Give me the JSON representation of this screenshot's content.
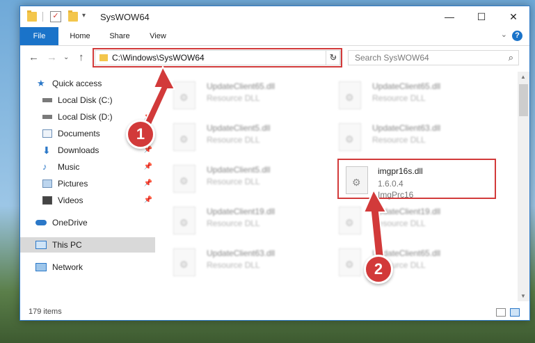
{
  "window": {
    "title": "SysWOW64",
    "controls": {
      "minimize": "—",
      "maximize": "☐",
      "close": "✕"
    }
  },
  "ribbon": {
    "tabs": [
      {
        "label": "File"
      },
      {
        "label": "Home"
      },
      {
        "label": "Share"
      },
      {
        "label": "View"
      }
    ],
    "help": "?"
  },
  "navigation": {
    "back": "←",
    "forward": "→",
    "recent": "⌄",
    "up": "↑",
    "address": "C:\\Windows\\SysWOW64",
    "address_dropdown": "⌄",
    "refresh": "↻",
    "search_placeholder": "Search SysWOW64",
    "search_icon": "⌕"
  },
  "nav_pane": {
    "items": [
      {
        "label": "Quick access",
        "icon": "star-icon"
      },
      {
        "label": "Local Disk (C:)",
        "icon": "drive-icon"
      },
      {
        "label": "Local Disk (D:)",
        "icon": "drive-icon"
      },
      {
        "label": "Documents",
        "icon": "documents-icon"
      },
      {
        "label": "Downloads",
        "icon": "download-icon"
      },
      {
        "label": "Music",
        "icon": "music-icon"
      },
      {
        "label": "Pictures",
        "icon": "pictures-icon"
      },
      {
        "label": "Videos",
        "icon": "videos-icon"
      },
      {
        "label": "OneDrive",
        "icon": "onedrive-icon"
      },
      {
        "label": "This PC",
        "icon": "computer-icon",
        "selected": true
      },
      {
        "label": "Network",
        "icon": "network-icon"
      }
    ]
  },
  "files": {
    "left_column": [
      {
        "name": "UpdateClient65.dll",
        "desc": "Resource DLL"
      },
      {
        "name": "UpdateClient5.dll",
        "desc": "Resource DLL"
      },
      {
        "name": "UpdateClient5.dll",
        "desc": "Resource DLL"
      },
      {
        "name": "UpdateClient19.dll",
        "desc": "Resource DLL"
      },
      {
        "name": "UpdateClient63.dll",
        "desc": "Resource DLL"
      }
    ],
    "right_column": [
      {
        "name": "UpdateClient65.dll",
        "desc": "Resource DLL"
      },
      {
        "name": "UpdateClient63.dll",
        "desc": "Resource DLL"
      },
      {
        "name": "UpdateClient19.dll",
        "desc": "Resource DLL"
      },
      {
        "name": "UpdateClient65.dll",
        "desc": "Resource DLL"
      }
    ],
    "highlighted": {
      "name": "imgpr16s.dll",
      "version": "1.6.0.4",
      "product": "ImgPrc16"
    }
  },
  "status": {
    "item_count": "179 items"
  },
  "annotations": {
    "step1": "1",
    "step2": "2"
  },
  "colors": {
    "accent": "#1a73c9",
    "annotation": "#d23a3a",
    "folder": "#f3c64c"
  }
}
